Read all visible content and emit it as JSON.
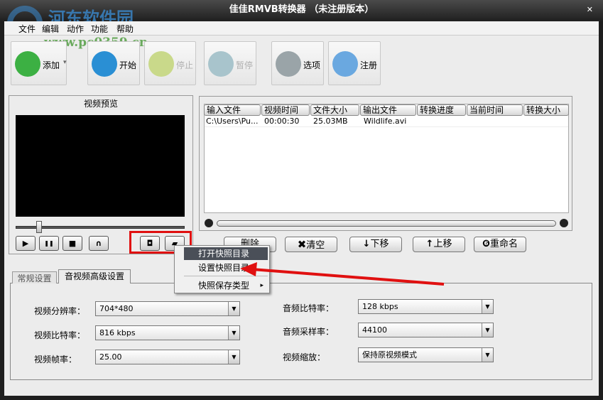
{
  "window": {
    "title": "佳佳RMVB转换器  （未注册版本）",
    "close": "✕",
    "watermark": {
      "name": "河东软件园",
      "url": "www.pc0359.cn"
    }
  },
  "menu": [
    "文件",
    "编辑",
    "动作",
    "功能",
    "帮助"
  ],
  "toolbar": [
    {
      "label": "添加",
      "icon": "plus-icon",
      "color": "#3cb043",
      "enabled": true,
      "dropdown": "▾"
    },
    {
      "label": "开始",
      "icon": "play-icon",
      "color": "#2a8fd4",
      "enabled": true
    },
    {
      "label": "停止",
      "icon": "stop-icon",
      "color": "#c9d98a",
      "enabled": false
    },
    {
      "label": "暂停",
      "icon": "pause-icon",
      "color": "#a8c4cc",
      "enabled": false
    },
    {
      "label": "选项",
      "icon": "gear-icon",
      "color": "#9aa4a8",
      "enabled": true
    },
    {
      "label": "注册",
      "icon": "basket-icon",
      "color": "#6aa8e0",
      "enabled": true
    }
  ],
  "preview": {
    "title": "视频预览",
    "slider_position": 0.14,
    "controls": [
      "▶",
      "❚❚",
      "■",
      "∩"
    ],
    "snapshot_icons": [
      "camera-icon",
      "folder-icon"
    ]
  },
  "files": {
    "columns": [
      "输入文件",
      "视频时间",
      "文件大小",
      "输出文件",
      "转换进度",
      "当前时间",
      "转换大小"
    ],
    "rows": [
      [
        "C:\\Users\\Pu...",
        "00:00:30",
        "25.03MB",
        "Wildlife.avi",
        "",
        "",
        ""
      ]
    ],
    "buttons": [
      "删除",
      "清空",
      "下移",
      "上移",
      "重命名"
    ]
  },
  "context_menu": {
    "items": [
      "打开快照目录",
      "设置快照目录",
      "快照保存类型"
    ],
    "submenu_arrow": "▸"
  },
  "tabs": [
    "常规设置",
    "音视频高级设置"
  ],
  "settings": {
    "left": [
      {
        "label": "视频分辨率：",
        "value": "704*480"
      },
      {
        "label": "视频比特率：",
        "value": "816 kbps"
      },
      {
        "label": "视频帧率：",
        "value": "25.00"
      }
    ],
    "right": [
      {
        "label": "音频比特率：",
        "value": "128 kbps"
      },
      {
        "label": "音频采样率：",
        "value": "44100"
      },
      {
        "label": "视频缩放：",
        "value": "保持原视频模式"
      }
    ]
  },
  "annotation_color": "#e01010"
}
